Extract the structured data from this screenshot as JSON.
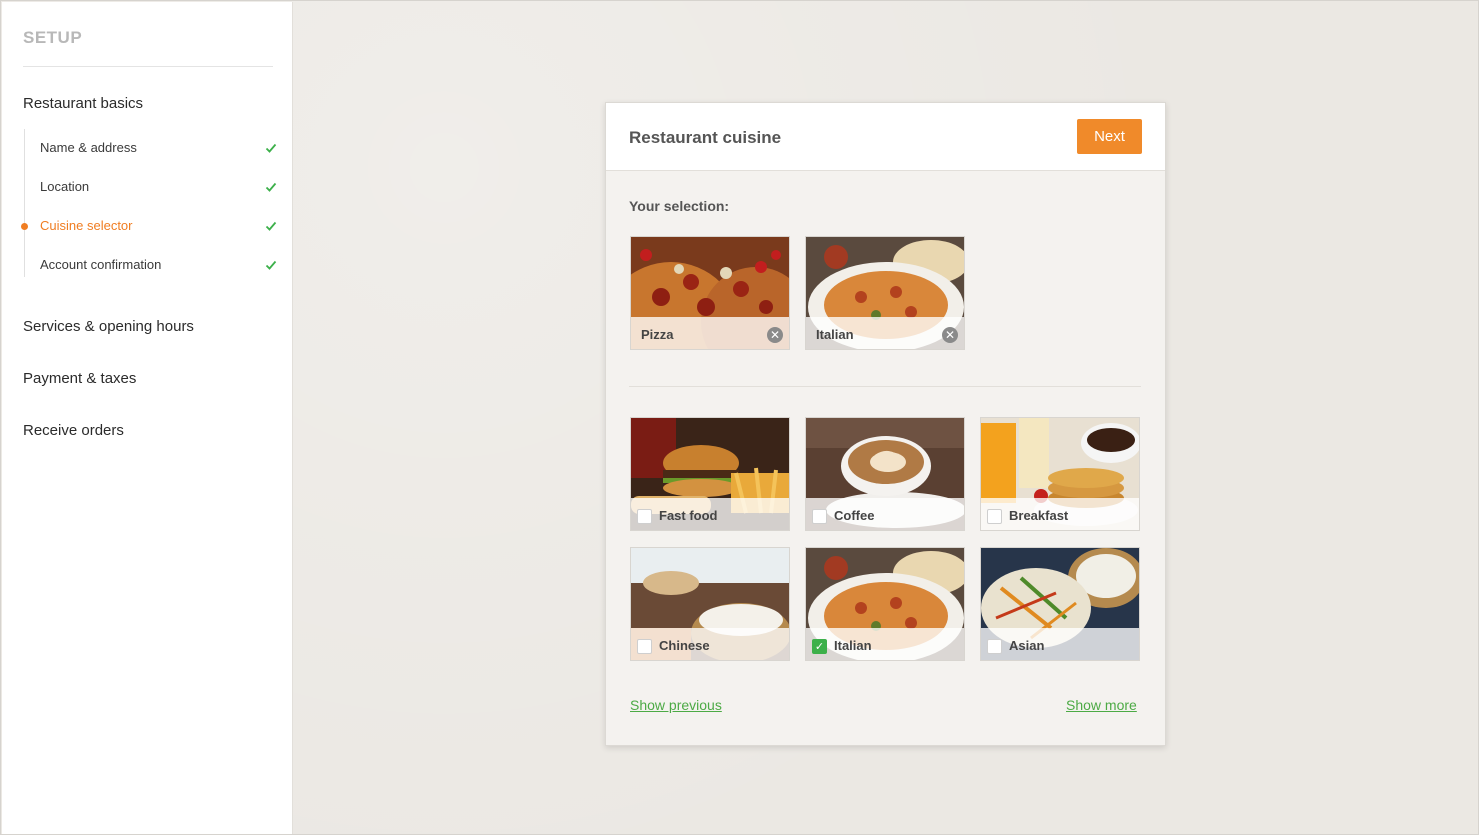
{
  "sidebar": {
    "title": "SETUP",
    "sections": {
      "restaurant_basics": "Restaurant basics",
      "services": "Services & opening hours",
      "payment": "Payment & taxes",
      "orders": "Receive orders"
    },
    "steps": [
      {
        "label": "Name & address",
        "done": true
      },
      {
        "label": "Location",
        "done": true
      },
      {
        "label": "Cuisine selector",
        "done": true,
        "active": true
      },
      {
        "label": "Account confirmation",
        "done": true
      }
    ]
  },
  "card": {
    "title": "Restaurant cuisine",
    "next_label": "Next",
    "selection_label": "Your selection:",
    "selected": [
      {
        "label": "Pizza"
      },
      {
        "label": "Italian"
      }
    ],
    "options": [
      {
        "label": "Fast food",
        "checked": false
      },
      {
        "label": "Coffee",
        "checked": false
      },
      {
        "label": "Breakfast",
        "checked": false
      },
      {
        "label": "Chinese",
        "checked": false
      },
      {
        "label": "Italian",
        "checked": true
      },
      {
        "label": "Asian",
        "checked": false
      }
    ],
    "show_previous": "Show previous",
    "show_more": "Show more"
  },
  "colors": {
    "accent": "#f08a2a",
    "active_step": "#f07d22",
    "check": "#3cb04a",
    "link": "#4caa45"
  }
}
